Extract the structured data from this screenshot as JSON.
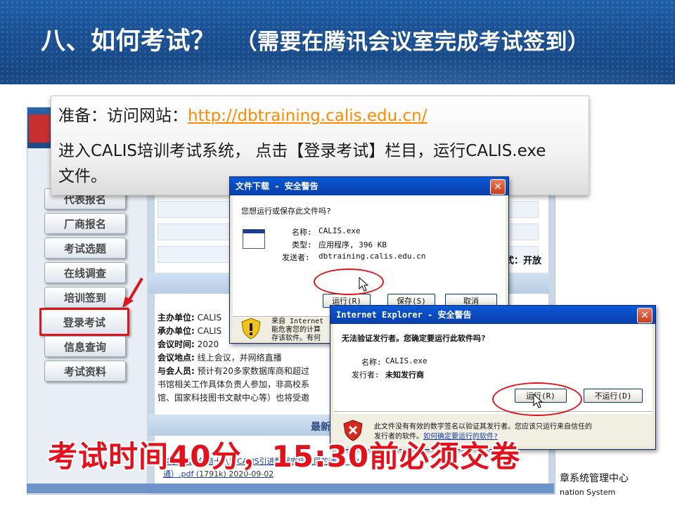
{
  "header": {
    "title": "八、如何考试？",
    "subtitle": "（需要在腾讯会议室完成考试签到）"
  },
  "callout": {
    "line1_prefix": "准备：访问网站：",
    "url": "http://dbtraining.calis.edu.cn/",
    "line2": "进入CALIS培训考试系统， 点击【登录考试】栏目，运行CALIS.exe文件。"
  },
  "site": {
    "menu": [
      "代表报名",
      "厂商报名",
      "考试选题",
      "在线调查",
      "培训签到",
      "登录考试",
      "信息查询",
      "考试资料"
    ],
    "active_menu": "登录考试",
    "status_text": "式：开放",
    "info_rows": [
      {
        "label": "主办单位:",
        "value": "CALIS"
      },
      {
        "label": "承办单位:",
        "value": "CALIS"
      },
      {
        "label": "会议时间:",
        "value": "2020"
      },
      {
        "label": "会议地点:",
        "value": "线上会议，并网络直播"
      },
      {
        "label": "与会人员:",
        "value": "预计有20多家数据库商和超过"
      },
      {
        "label": "",
        "value": "书馆相关工作具体负责人参加，非高校系"
      },
      {
        "label": "",
        "value": "馆、国家科技图书文献中心等）也将受邀"
      }
    ],
    "latest_label": "最新",
    "link1": "关于2020年第十八届CALIS引进数据库培训周的通知（含",
    "link2": "通）.pdf",
    "link2_meta": "(1791k) 2020-09-02"
  },
  "dialog1": {
    "title": "文件下载 - 安全警告",
    "question": "您想运行或保存此文件吗?",
    "name_label": "名称:",
    "name_value": "CALIS.exe",
    "type_label": "类型:",
    "type_value": "应用程序, 396 KB",
    "from_label": "发送者:",
    "from_value": "dbtraining.calis.edu.cn",
    "run": "运行(R)",
    "save": "保存(S)",
    "cancel": "取消",
    "warning_line1": "来自 Internet",
    "warning_line2": "能危害您的计算",
    "warning_line3": "存该软件。有何"
  },
  "dialog2": {
    "title": "Internet Explorer - 安全警告",
    "question": "无法验证发行者。您确定要运行此软件吗?",
    "name_label": "名称:",
    "name_value": "CALIS.exe",
    "publisher_label": "发行者:",
    "publisher_value": "未知发行商",
    "run": "运行(R)",
    "dont_run": "不运行(D)",
    "warning_text": "此文件没有有效的数字签名以验证其发行者。您应该只运行来自信任的",
    "warning_text2": "发行者的软件。",
    "warning_link": "如何确定要运行的软件?"
  },
  "notice": "考试时间40分，15:30前必须交卷",
  "footer": {
    "cn": "章系统管理中心",
    "en": "nation System"
  },
  "colors": {
    "header_blue": "#1a4f91",
    "url_orange": "#ff8c00",
    "alert_red": "#e3111b",
    "xp_title_blue": "#0b4bc4"
  }
}
